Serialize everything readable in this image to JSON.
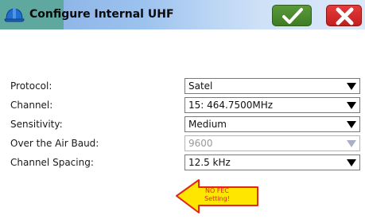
{
  "window": {
    "title": "Configure Internal UHF",
    "icon": "hard-hat-icon",
    "ok_icon": "checkmark-icon",
    "cancel_icon": "close-x-icon",
    "colors": {
      "ok": "#4a8d2d",
      "cancel": "#d42a2a"
    }
  },
  "form": {
    "fields": [
      {
        "label": "Protocol:",
        "value": "Satel",
        "enabled": true
      },
      {
        "label": "Channel:",
        "value": "15: 464.7500MHz",
        "enabled": true
      },
      {
        "label": "Sensitivity:",
        "value": "Medium",
        "enabled": true
      },
      {
        "label": "Over the Air Baud:",
        "value": "9600",
        "enabled": false
      },
      {
        "label": "Channel Spacing:",
        "value": "12.5 kHz",
        "enabled": true
      }
    ]
  },
  "annotation": {
    "line1": "NO FEC",
    "line2": "Setting!",
    "color": "#e2261c"
  }
}
